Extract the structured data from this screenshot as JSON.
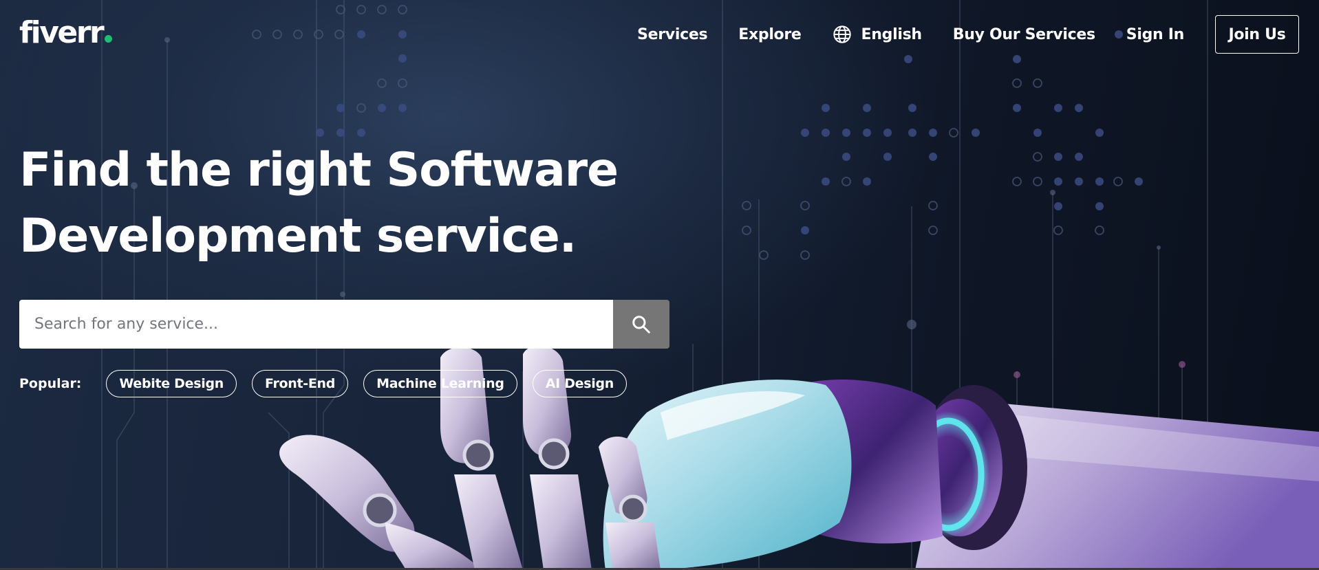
{
  "brand": {
    "name": "fiverr",
    "dot_color": "#1dbf73"
  },
  "nav": {
    "services": "Services",
    "explore": "Explore",
    "language": "English",
    "language_icon": "globe-icon",
    "buy_services": "Buy Our Services",
    "sign_in": "Sign In",
    "join": "Join Us"
  },
  "hero": {
    "headline_line1": "Find the right Software",
    "headline_line2": "Development service."
  },
  "search": {
    "placeholder": "Search for any service...",
    "value": "",
    "button_icon": "search-icon",
    "button_color": "#767676"
  },
  "popular": {
    "label": "Popular:",
    "tags": [
      "Webite Design",
      "Front-End",
      "Machine Learning",
      "AI Design"
    ]
  }
}
